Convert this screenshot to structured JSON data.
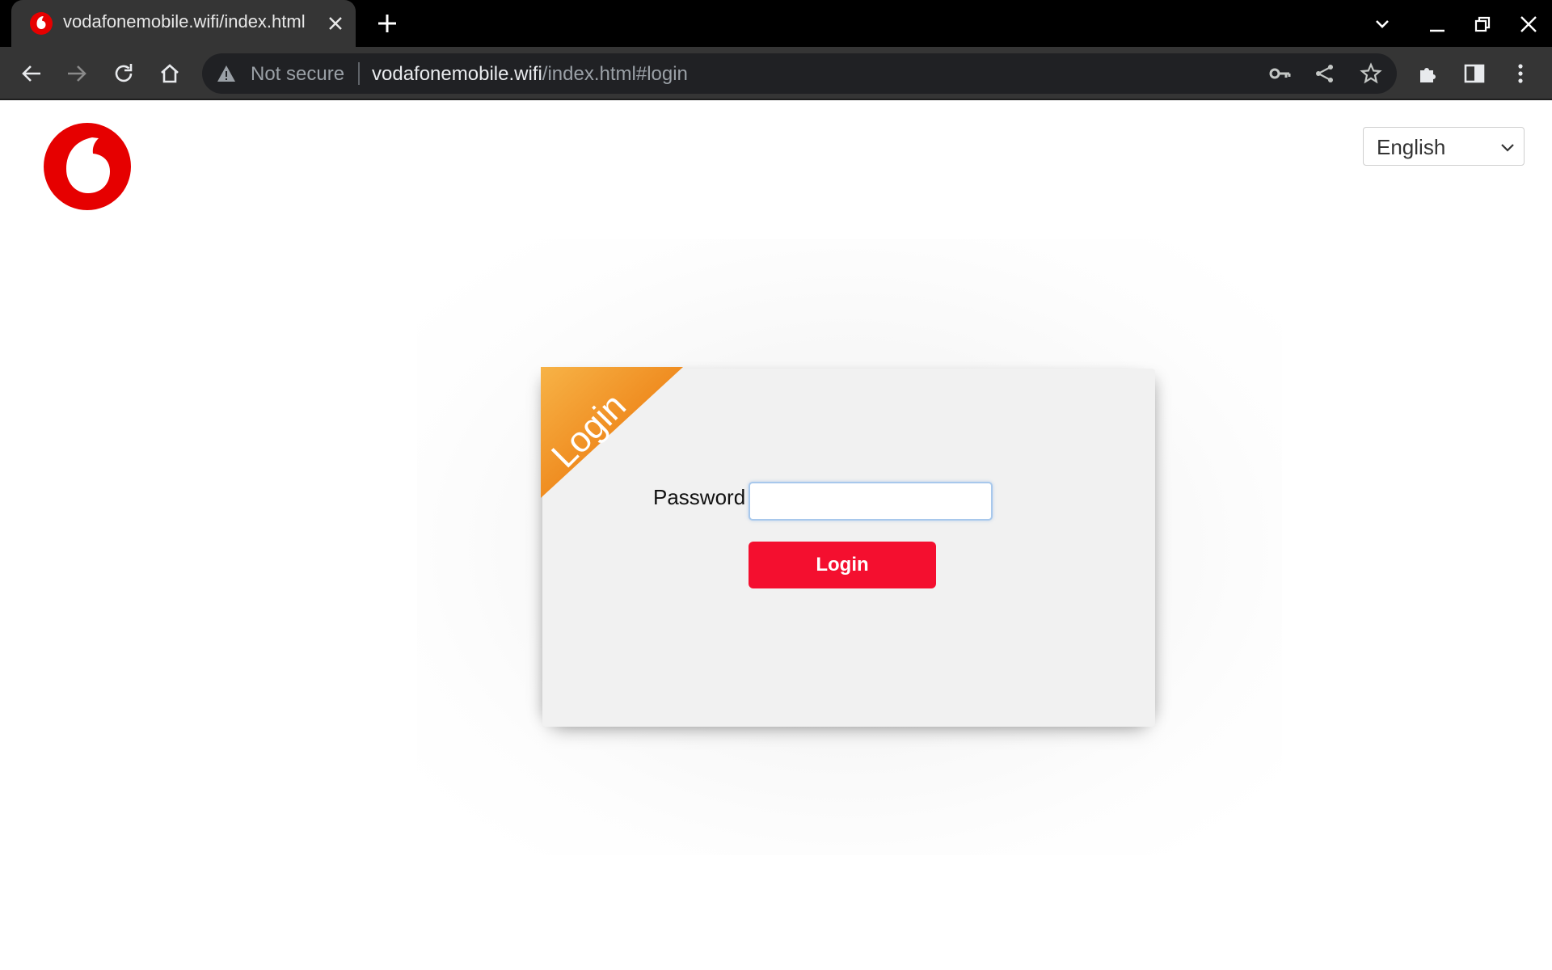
{
  "browser": {
    "tab": {
      "title": "vodafonemobile.wifi/index.html"
    },
    "omnibox": {
      "security_text": "Not secure",
      "url_host": "vodafonemobile.wifi",
      "url_path": "/index.html#login"
    }
  },
  "page": {
    "language": {
      "selected": "English"
    },
    "login": {
      "ribbon_text": "Login",
      "password_label": "Password",
      "password_value": "",
      "button_label": "Login"
    }
  },
  "colors": {
    "brand_red": "#e60000",
    "button_red": "#f40f2f",
    "ribbon_orange": "#f39a2c"
  },
  "icons": [
    "vodafone-favicon-icon",
    "close-icon",
    "plus-icon",
    "chevron-down-icon",
    "minimize-icon",
    "restore-icon",
    "back-icon",
    "forward-icon",
    "reload-icon",
    "home-icon",
    "warning-icon",
    "key-icon",
    "share-icon",
    "star-icon",
    "extensions-icon",
    "side-panel-icon",
    "menu-icon"
  ]
}
